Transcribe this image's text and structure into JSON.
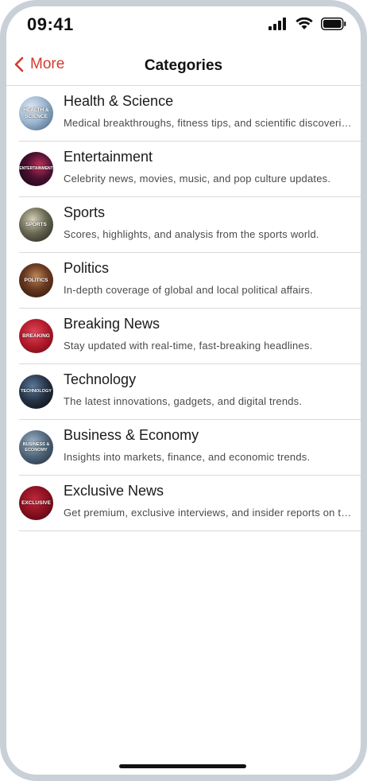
{
  "status_bar": {
    "time": "09:41"
  },
  "nav": {
    "back_label": "More",
    "title": "Categories"
  },
  "colors": {
    "accent": "#d23a2e"
  },
  "categories": [
    {
      "title": "Health & Science",
      "subtitle": "Medical breakthroughs, fitness tips, and scientific discoveries.",
      "avatar_label": "HEALTH &\nSCIENCE"
    },
    {
      "title": "Entertainment",
      "subtitle": "Celebrity news, movies, music, and pop culture updates.",
      "avatar_label": "ENTERTAINMENT"
    },
    {
      "title": "Sports",
      "subtitle": "Scores, highlights, and analysis from the sports world.",
      "avatar_label": "SPORTS"
    },
    {
      "title": "Politics",
      "subtitle": "In-depth coverage of global and local political affairs.",
      "avatar_label": "POLITICS"
    },
    {
      "title": "Breaking News",
      "subtitle": "Stay updated with real-time, fast-breaking headlines.",
      "avatar_label": "BREAKING"
    },
    {
      "title": "Technology",
      "subtitle": "The latest innovations, gadgets, and digital trends.",
      "avatar_label": "TECHNOLOGY"
    },
    {
      "title": "Business & Economy",
      "subtitle": "Insights into markets, finance, and economic trends.",
      "avatar_label": "BUSINESS &\nECONOMY"
    },
    {
      "title": "Exclusive News",
      "subtitle": "Get premium, exclusive interviews, and insider reports on top stories.",
      "avatar_label": "EXCLUSIVE"
    }
  ]
}
